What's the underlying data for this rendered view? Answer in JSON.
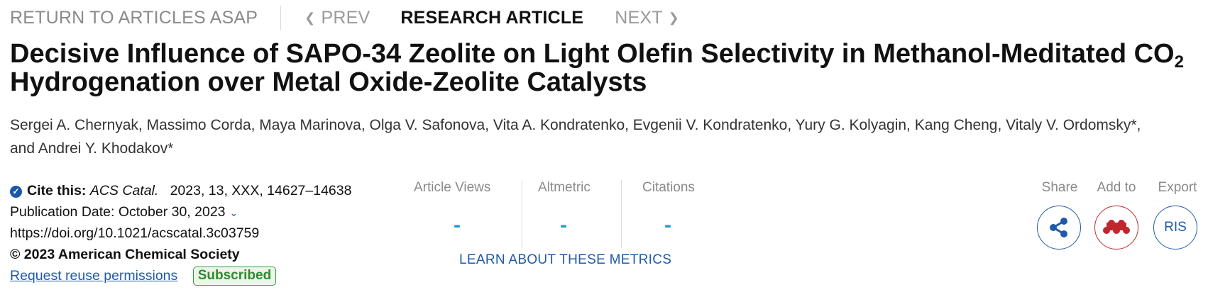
{
  "nav": {
    "return_label": "RETURN TO ARTICLES ASAP",
    "prev_label": "PREV",
    "article_type": "RESEARCH ARTICLE",
    "next_label": "NEXT"
  },
  "article": {
    "title_part1": "Decisive Influence of SAPO-34 Zeolite on Light Olefin Selectivity in Methanol-Meditated CO",
    "title_sub": "2",
    "title_part2": " Hydrogenation over Metal Oxide-Zeolite Catalysts",
    "authors": "Sergei A. Chernyak, Massimo Corda, Maya Marinova, Olga V. Safonova, Vita A. Kondratenko, Evgenii V. Kondratenko, Yury G. Kolyagin, Kang Cheng, Vitaly V. Ordomsky*, and Andrei Y. Khodakov*"
  },
  "citation": {
    "cite_label": "Cite this:",
    "journal": "ACS Catal.",
    "details": "2023, 13, XXX, 14627–14638",
    "pub_date_label": "Publication Date: October 30, 2023",
    "doi": "https://doi.org/10.1021/acscatal.3c03759",
    "copyright": "© 2023 American Chemical Society",
    "reuse_link": "Request reuse permissions",
    "access_badge": "Subscribed"
  },
  "metrics": {
    "views_label": "Article Views",
    "views_value": "-",
    "altmetric_label": "Altmetric",
    "altmetric_value": "-",
    "citations_label": "Citations",
    "citations_value": "-",
    "learn_link": "LEARN ABOUT THESE METRICS"
  },
  "actions": {
    "share_label": "Share",
    "add_label": "Add to",
    "export_label": "Export",
    "export_button": "RIS",
    "share_icon": "share-icon",
    "add_icon": "mendeley-icon"
  },
  "colors": {
    "accent": "#1f5ba8",
    "metric_value": "#1e9ad6",
    "mendeley_red": "#c0272d",
    "subscribed_green": "#2e8b2e"
  }
}
